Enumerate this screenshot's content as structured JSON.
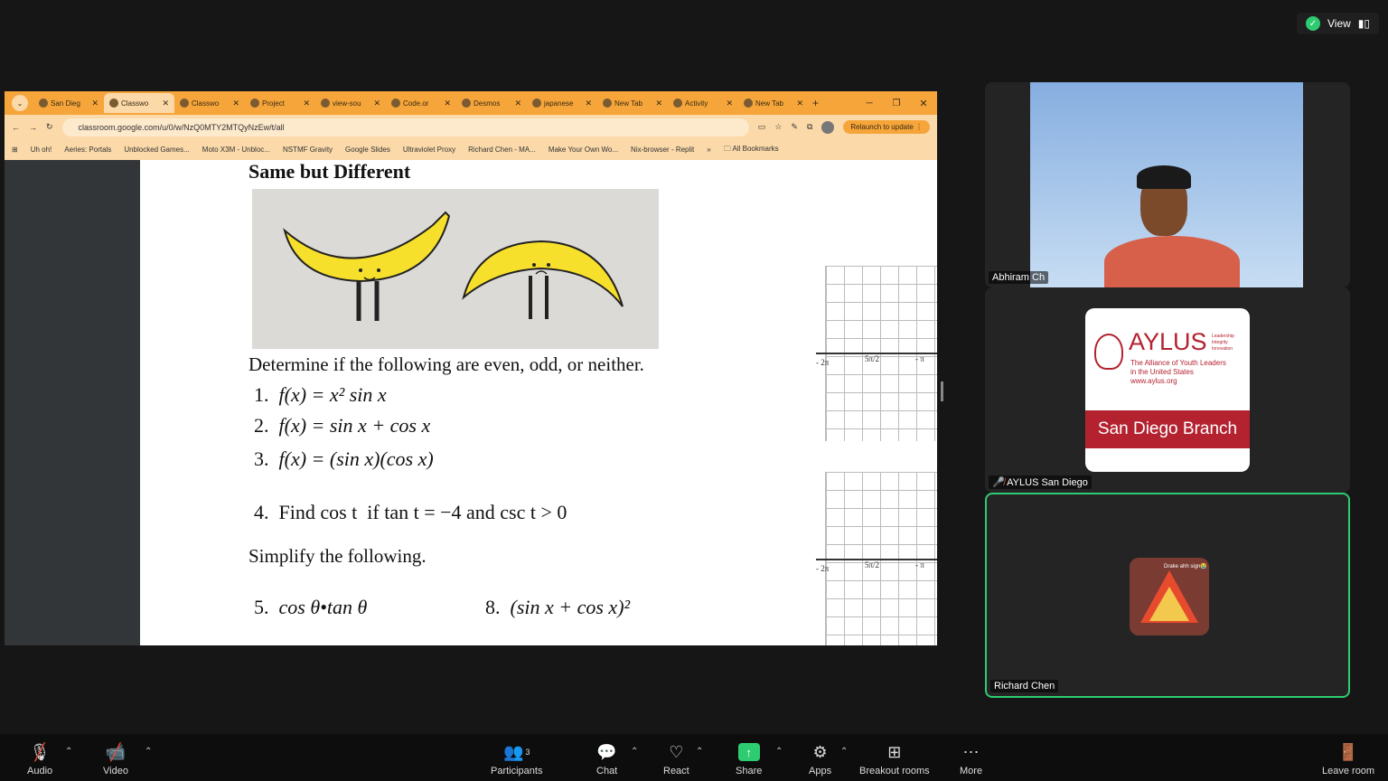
{
  "topbar": {
    "view_label": "View"
  },
  "browser": {
    "tabs": [
      "San Dieg",
      "Classwo",
      "Classwo",
      "Project",
      "view-sou",
      "Code.or",
      "Desmos",
      "japanese",
      "New Tab",
      "Activity",
      "New Tab"
    ],
    "new_tab": "+",
    "url": "classroom.google.com/u/0/w/NzQ0MTY2MTQyNzEw/t/all",
    "relaunch": "Relaunch to update",
    "bookmarks": [
      "Uh oh!",
      "Aeries: Portals",
      "Unblocked Games...",
      "Moto X3M - Unbloc...",
      "NSTMF Gravity",
      "Google Slides",
      "Ultraviolet Proxy",
      "Richard Chen - MA...",
      "Make Your Own Wo...",
      "Nix-browser - Replit"
    ],
    "bookmarks_more": "»",
    "all_bookmarks": "All Bookmarks"
  },
  "document": {
    "heading": "Same but Different",
    "instruction": "Determine if the following are even, odd, or neither.",
    "problems": [
      {
        "num": "1.",
        "expr": "f(x) = x² sin x"
      },
      {
        "num": "2.",
        "expr": "f(x) = sin x + cos x"
      },
      {
        "num": "3.",
        "expr": "f(x) = (sin x)(cos x)"
      },
      {
        "num": "4.",
        "expr": "Find cos t  if tan t = −4 and csc t > 0"
      },
      {
        "num": "5.",
        "expr": "cos θ•tan θ"
      },
      {
        "num": "8.",
        "expr": "(sin x + cos x)²"
      }
    ],
    "simplify": "Simplify the following.",
    "axis_labels": [
      "- 2π",
      "5π/2",
      "- π"
    ]
  },
  "participants_panel": [
    {
      "name": "Abhiram Ch"
    },
    {
      "name": "AYLUS San Diego",
      "logo_title": "AYLUS",
      "logo_side": [
        "Leadership",
        "Integrity",
        "Innovation"
      ],
      "logo_tagline": [
        "The Alliance of Youth Leaders",
        "in the United States",
        "www.aylus.org"
      ],
      "branch": "San Diego Branch"
    },
    {
      "name": "Richard Chen",
      "avatar_caption": "Drake ahh sign😭",
      "active_speaker_color": "#2ecc71"
    }
  ],
  "toolbar": {
    "audio": "Audio",
    "video": "Video",
    "participants": "Participants",
    "participant_count": "3",
    "chat": "Chat",
    "react": "React",
    "share": "Share",
    "apps": "Apps",
    "breakout": "Breakout rooms",
    "more": "More",
    "leave": "Leave room"
  }
}
